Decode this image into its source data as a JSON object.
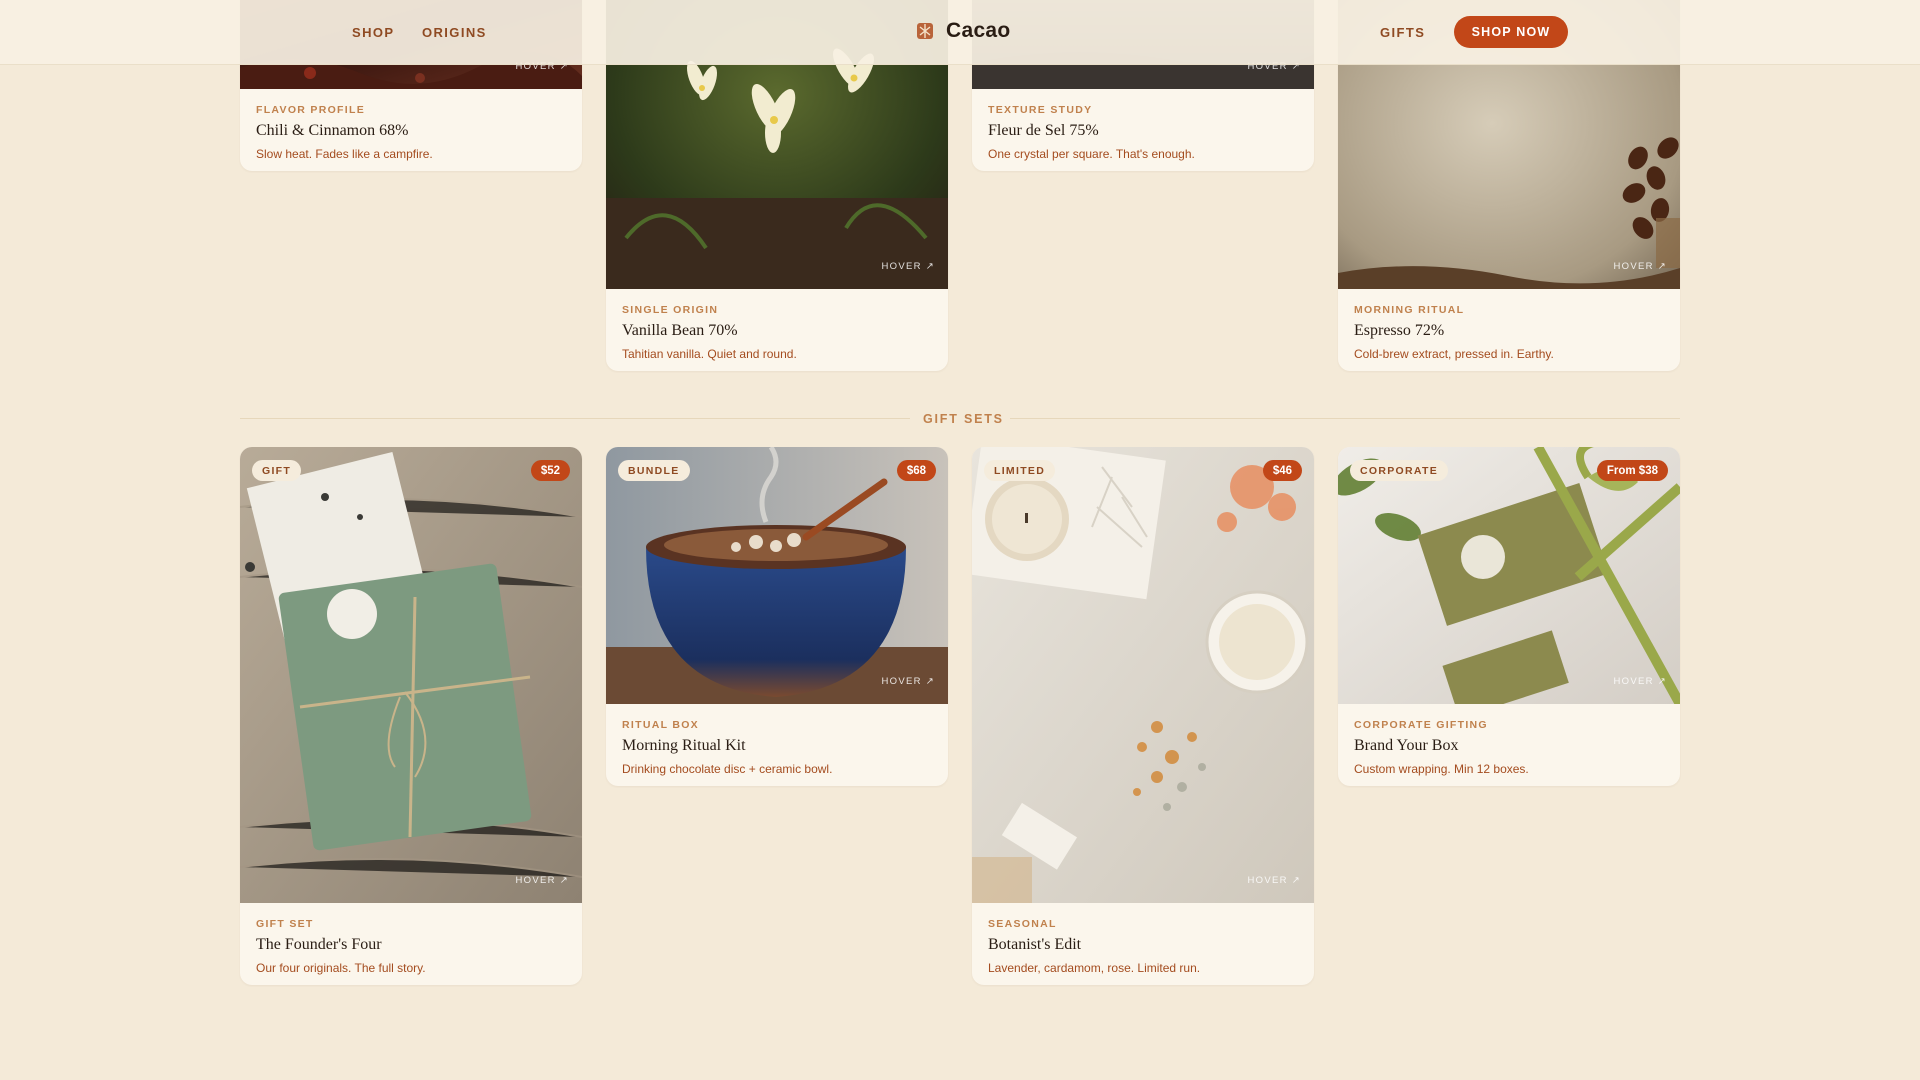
{
  "nav": {
    "shop": "SHOP",
    "origins": "ORIGINS",
    "gifts": "GIFTS",
    "cta": "SHOP NOW",
    "brand": "Cacao"
  },
  "hover_hint": "HOVER ↗",
  "colors": {
    "accent": "#c24718",
    "background": "#f4ead8",
    "card": "#fbf6ec",
    "eyebrow": "#c0814d"
  },
  "flavor_cards": [
    {
      "eyebrow": "FLAVOR PROFILE",
      "title": "Chili & Cinnamon 68%",
      "desc": "Slow heat. Fades like a campfire."
    },
    {
      "eyebrow": "SINGLE ORIGIN",
      "title": "Vanilla Bean 70%",
      "desc": "Tahitian vanilla. Quiet and round."
    },
    {
      "eyebrow": "TEXTURE STUDY",
      "title": "Fleur de Sel 75%",
      "desc": "One crystal per square. That's enough."
    },
    {
      "eyebrow": "MORNING RITUAL",
      "title": "Espresso 72%",
      "desc": "Cold-brew extract, pressed in. Earthy."
    }
  ],
  "gift_section": {
    "label": "GIFT SETS"
  },
  "gift_cards": [
    {
      "tag": "GIFT",
      "price": "$52",
      "eyebrow": "GIFT SET",
      "title": "The Founder's Four",
      "desc": "Our four originals. The full story."
    },
    {
      "tag": "BUNDLE",
      "price": "$68",
      "eyebrow": "RITUAL BOX",
      "title": "Morning Ritual Kit",
      "desc": "Drinking chocolate disc + ceramic bowl."
    },
    {
      "tag": "LIMITED",
      "price": "$46",
      "eyebrow": "SEASONAL",
      "title": "Botanist's Edit",
      "desc": "Lavender, cardamom, rose. Limited run."
    },
    {
      "tag": "CORPORATE",
      "price": "From $38",
      "eyebrow": "CORPORATE GIFTING",
      "title": "Brand Your Box",
      "desc": "Custom wrapping. Min 12 boxes."
    }
  ]
}
